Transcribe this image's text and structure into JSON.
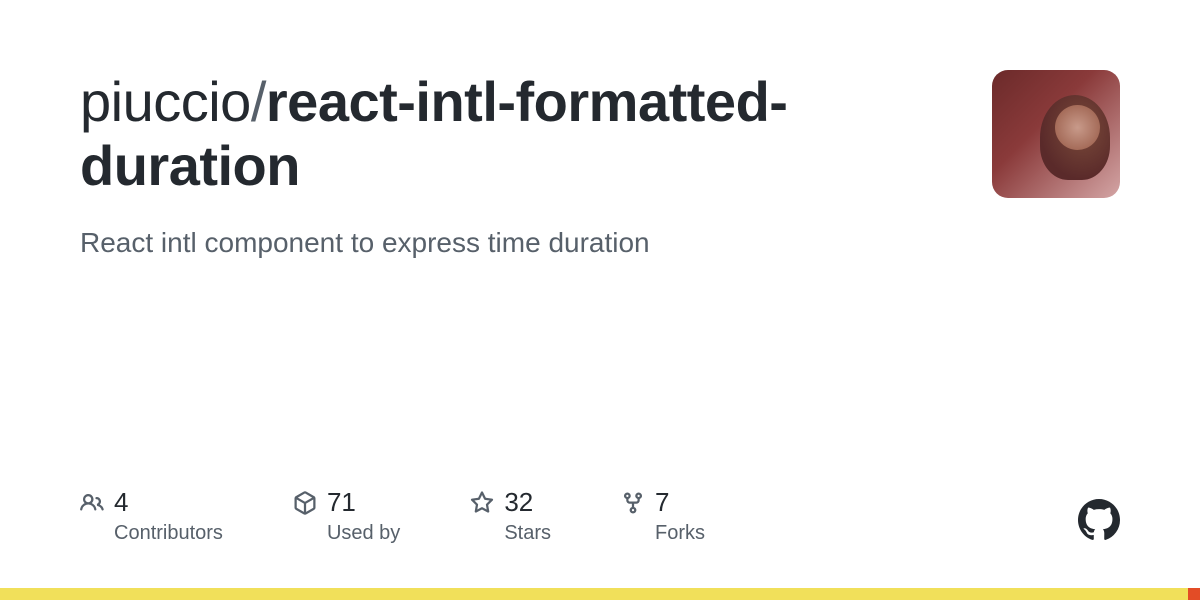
{
  "repo": {
    "owner": "piuccio",
    "separator": "/",
    "name": "react-intl-formatted-duration",
    "description": "React intl component to express time duration"
  },
  "stats": [
    {
      "icon": "people-icon",
      "value": "4",
      "label": "Contributors"
    },
    {
      "icon": "package-icon",
      "value": "71",
      "label": "Used by"
    },
    {
      "icon": "star-icon",
      "value": "32",
      "label": "Stars"
    },
    {
      "icon": "fork-icon",
      "value": "7",
      "label": "Forks"
    }
  ],
  "languages": [
    {
      "color": "#f1e05a",
      "percent": 99
    },
    {
      "color": "#e34c26",
      "percent": 1
    }
  ]
}
